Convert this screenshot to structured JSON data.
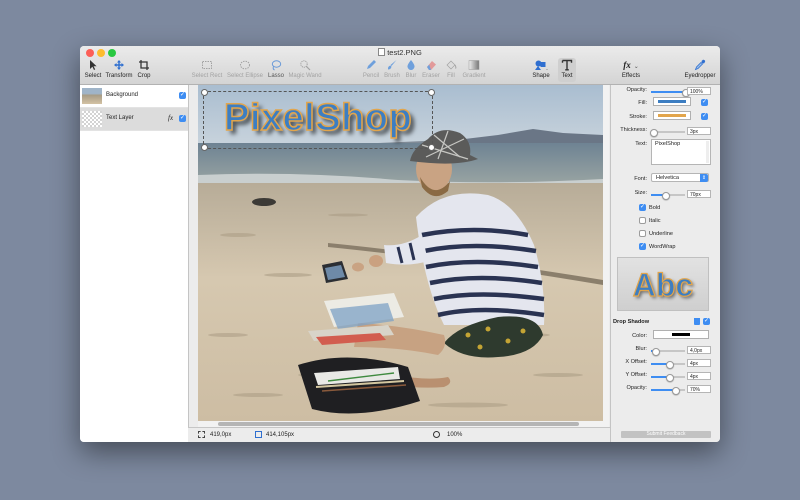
{
  "window": {
    "title": "test2.PNG"
  },
  "colors": {
    "accent": "#3e8df2",
    "fill": "#3d7ec2",
    "stroke": "#e2a54c",
    "shadow": "#000000",
    "close": "#fc5f57",
    "minimize": "#fdbc2e",
    "zoom": "#29c840"
  },
  "toolbar": {
    "select": "Select",
    "transform": "Transform",
    "crop": "Crop",
    "select_rect": "Select Rect",
    "select_ellipse": "Select Ellipse",
    "lasso": "Lasso",
    "magic_wand": "Magic Wand",
    "pencil": "Pencil",
    "brush": "Brush",
    "blur": "Blur",
    "eraser": "Eraser",
    "fill": "Fill",
    "gradient": "Gradient",
    "shape": "Shape",
    "text": "Text",
    "effects": "Effects",
    "fx_glyph": "fx",
    "eyedropper": "Eyedropper"
  },
  "layers": [
    {
      "name": "Background",
      "visible": true
    },
    {
      "name": "Text Layer",
      "visible": true,
      "fx": "fx"
    }
  ],
  "canvas": {
    "text": "PixelShop"
  },
  "statusbar": {
    "size": "419,0px",
    "position": "414,105px",
    "zoom": "100%"
  },
  "properties": {
    "opacity_label": "Opacity:",
    "opacity_value": "100%",
    "opacity_level": 1.0,
    "fill_label": "Fill:",
    "fill_enabled": true,
    "stroke_label": "Stroke:",
    "stroke_enabled": true,
    "thickness_label": "Thickness:",
    "thickness_value": "3px",
    "thickness_level": 0.05,
    "text_label": "Text:",
    "text_value": "PixelShop",
    "font_label": "Font:",
    "font_value": "Helvetica",
    "size_label": "Size:",
    "size_value": "70px",
    "size_level": 0.42,
    "bold": {
      "label": "Bold",
      "checked": true
    },
    "italic": {
      "label": "Italic",
      "checked": false
    },
    "underline": {
      "label": "Underline",
      "checked": false
    },
    "wordwrap": {
      "label": "WordWrap",
      "checked": true
    },
    "preview_text": "Abc",
    "drop_shadow_label": "Drop Shadow",
    "drop_shadow_enabled": true,
    "color_label": "Color:",
    "blur_label": "Blur:",
    "blur_value": "4,0px",
    "blur_level": 0.13,
    "xoffset_label": "X Offset:",
    "xoffset_value": "4px",
    "xoffset_level": 0.52,
    "yoffset_label": "Y Offset:",
    "yoffset_value": "4px",
    "yoffset_level": 0.52,
    "sopacity_label": "Opacity:",
    "sopacity_value": "70%",
    "sopacity_level": 0.7,
    "feedback_button": "Submit Feedback"
  }
}
